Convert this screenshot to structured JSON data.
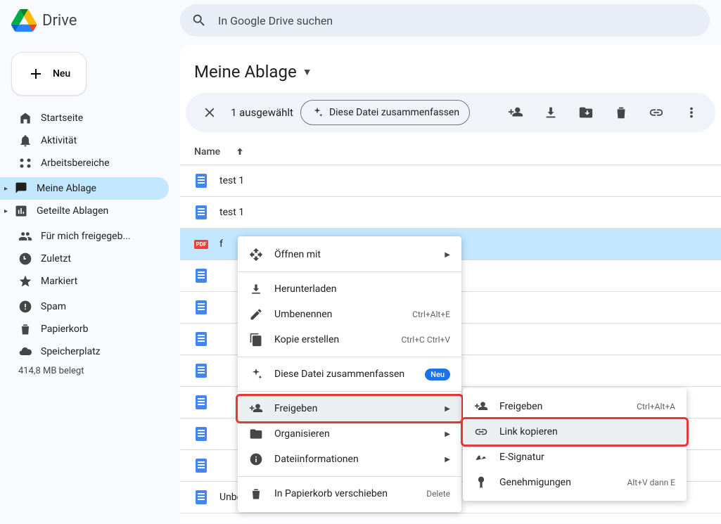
{
  "app_name": "Drive",
  "search_placeholder": "In Google Drive suchen",
  "new_button": "Neu",
  "nav": {
    "startseite": "Startseite",
    "aktivitaet": "Aktivität",
    "arbeitsbereiche": "Arbeitsbereiche",
    "meine_ablage": "Meine Ablage",
    "geteilte_ablagen": "Geteilte Ablagen",
    "freigegeben": "Für mich freigegeb...",
    "zuletzt": "Zuletzt",
    "markiert": "Markiert",
    "spam": "Spam",
    "papierkorb": "Papierkorb",
    "speicherplatz": "Speicherplatz"
  },
  "storage_used": "414,8 MB belegt",
  "page_title": "Meine Ablage",
  "action_bar": {
    "selected_text": "1 ausgewählt",
    "summarize": "Diese Datei zusammenfassen"
  },
  "column_header": "Name",
  "files": [
    {
      "name": "test 1",
      "type": "doc"
    },
    {
      "name": "test 1",
      "type": "doc"
    },
    {
      "name": "f",
      "type": "pdf",
      "selected": true
    },
    {
      "name": "",
      "type": "doc"
    },
    {
      "name": "",
      "type": "doc"
    },
    {
      "name": "",
      "type": "doc"
    },
    {
      "name": "",
      "type": "doc"
    },
    {
      "name": "",
      "type": "doc"
    },
    {
      "name": "",
      "type": "doc"
    },
    {
      "name": "",
      "type": "doc"
    },
    {
      "name": "Unbenanntes Dokument",
      "type": "doc"
    }
  ],
  "context_menu": {
    "open_with": "Öffnen mit",
    "download": "Herunterladen",
    "rename": "Umbenennen",
    "rename_sc": "Ctrl+Alt+E",
    "copy": "Kopie erstellen",
    "copy_sc": "Ctrl+C Ctrl+V",
    "summarize": "Diese Datei zusammenfassen",
    "summarize_badge": "Neu",
    "share": "Freigeben",
    "organize": "Organisieren",
    "info": "Dateiinformationen",
    "trash": "In Papierkorb verschieben",
    "trash_sc": "Delete"
  },
  "share_submenu": {
    "share": "Freigeben",
    "share_sc": "Ctrl+Alt+A",
    "copy_link": "Link kopieren",
    "esignature": "E-Signatur",
    "approvals": "Genehmigungen",
    "approvals_sc": "Alt+V dann E"
  }
}
